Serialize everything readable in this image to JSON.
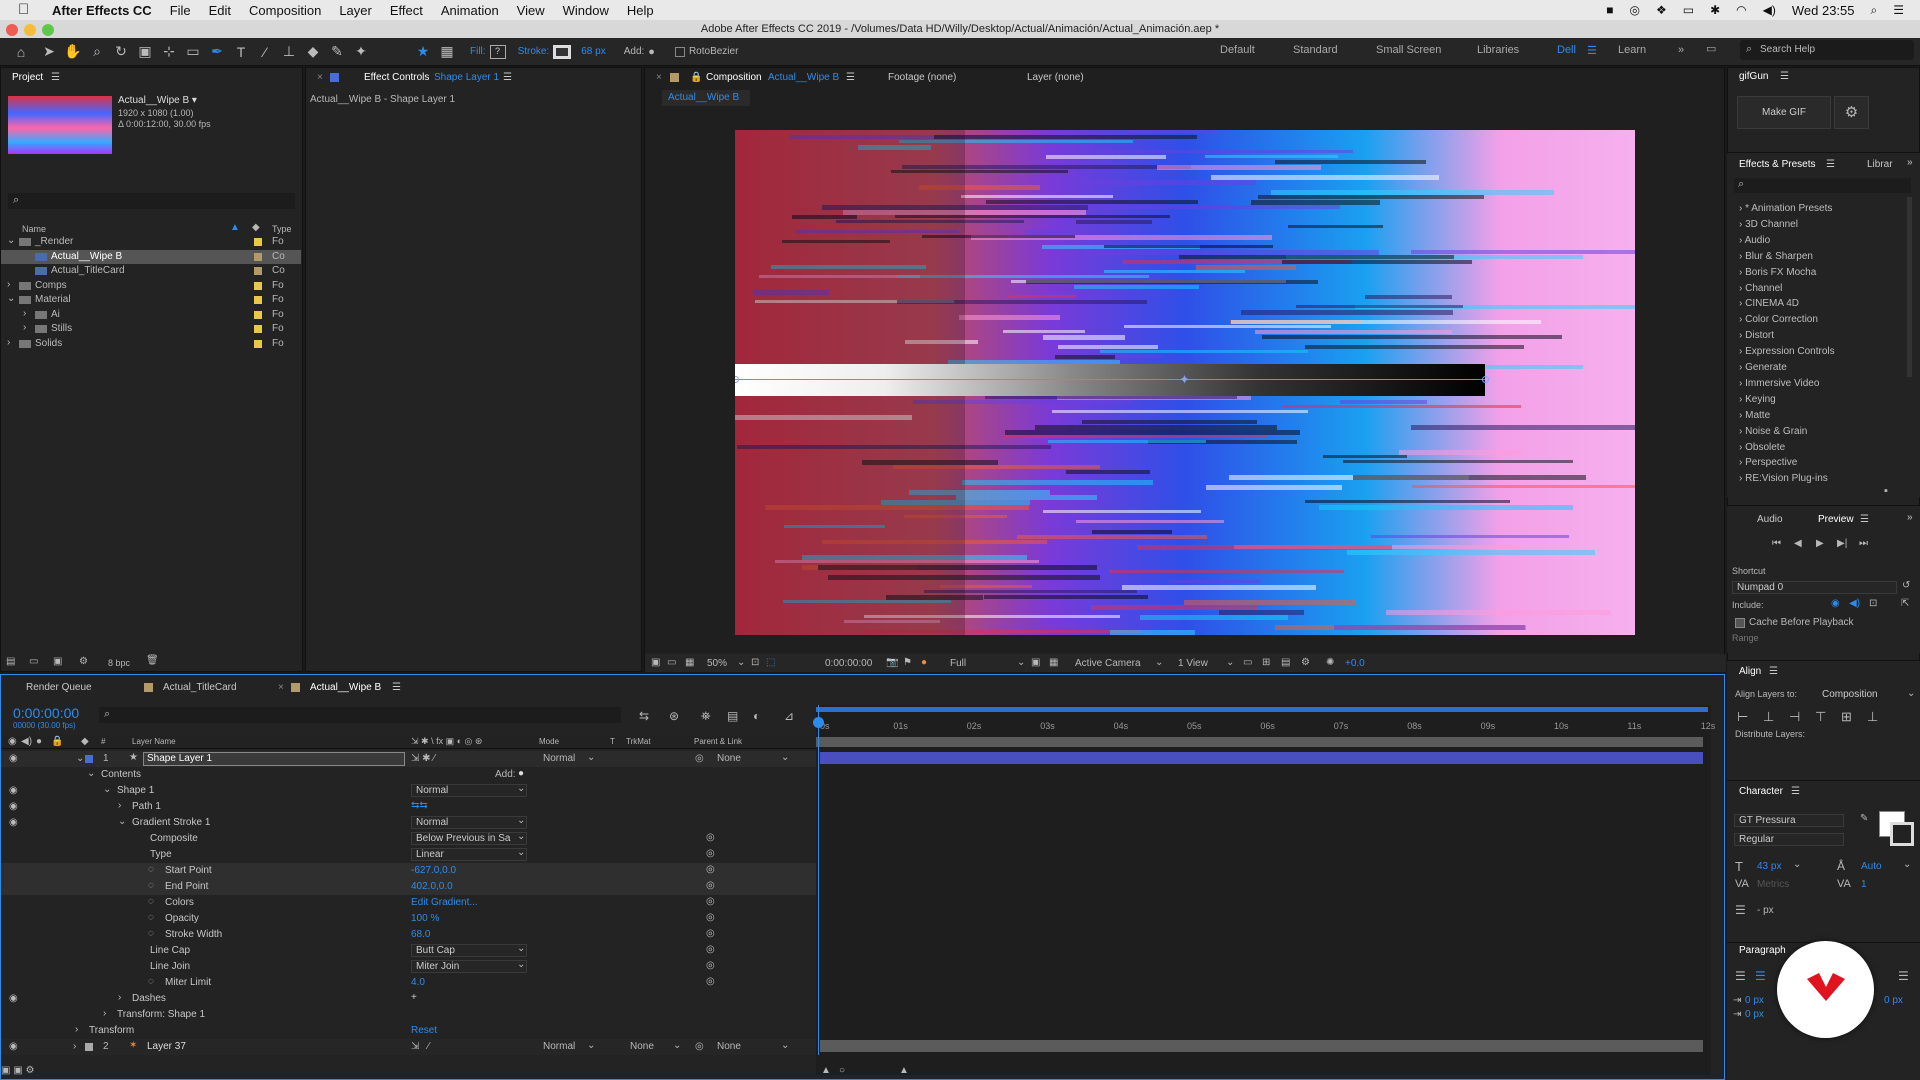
{
  "menubar": {
    "app_name": "After Effects CC",
    "items": [
      "File",
      "Edit",
      "Composition",
      "Layer",
      "Effect",
      "Animation",
      "View",
      "Window",
      "Help"
    ],
    "clock": "Wed 23:55"
  },
  "window_title": "Adobe After Effects CC 2019 - /Volumes/Data HD/Willy/Desktop/Actual/Animación/Actual_Animación.aep *",
  "toolbar": {
    "fill_label": "Fill:",
    "stroke_label": "Stroke:",
    "stroke_width": "68 px",
    "add_label": "Add:",
    "rotobezier_label": "RotoBezier",
    "workspaces": [
      "Default",
      "Standard",
      "Small Screen",
      "Libraries",
      "Dell",
      "Learn"
    ],
    "active_workspace": "Dell",
    "search_placeholder": "Search Help"
  },
  "project_panel": {
    "tab": "Project",
    "thumb_name": "Actual__Wipe B ▾",
    "thumb_info1": "1920 x 1080 (1.00)",
    "thumb_info2": "Δ 0:00:12:00, 30.00 fps",
    "col_name": "Name",
    "col_type": "Type",
    "bpc": "8 bpc",
    "items": [
      {
        "name": "_Render",
        "type": "Fo",
        "color": "#e8c84a"
      },
      {
        "name": "Actual__Wipe B",
        "type": "Co",
        "color": "#b49a6a"
      },
      {
        "name": "Actual_TitleCard",
        "type": "Co",
        "color": "#b49a6a"
      },
      {
        "name": "Comps",
        "type": "Fo",
        "color": "#e8c84a"
      },
      {
        "name": "Material",
        "type": "Fo",
        "color": "#e8c84a"
      },
      {
        "name": "Ai",
        "type": "Fo",
        "color": "#e8c84a"
      },
      {
        "name": "Stills",
        "type": "Fo",
        "color": "#e8c84a"
      },
      {
        "name": "Solids",
        "type": "Fo",
        "color": "#e8c84a"
      }
    ]
  },
  "effect_controls": {
    "tab_prefix": "Effect Controls",
    "tab_layer": "Shape Layer 1",
    "subtitle": "Actual__Wipe B - Shape Layer 1"
  },
  "composition_panel": {
    "tab_prefix": "Composition",
    "tab_comp": "Actual__Wipe B",
    "footage_tab": "Footage (none)",
    "layer_tab": "Layer (none)",
    "breadcrumb": "Actual__Wipe B",
    "zoom": "50%",
    "timecode": "0:00:00:00",
    "resolution": "Full",
    "camera": "Active Camera",
    "views": "1 View",
    "exposure": "+0.0"
  },
  "right_panel": {
    "gifgun_tab": "gifGun",
    "make_gif": "Make GIF",
    "effects_tab": "Effects & Presets",
    "libraries_tab": "Librar",
    "effects_list": [
      "* Animation Presets",
      "3D Channel",
      "Audio",
      "Blur & Sharpen",
      "Boris FX Mocha",
      "Channel",
      "CINEMA 4D",
      "Color Correction",
      "Distort",
      "Expression Controls",
      "Generate",
      "Immersive Video",
      "Keying",
      "Matte",
      "Noise & Grain",
      "Obsolete",
      "Perspective",
      "RE:Vision Plug-ins"
    ],
    "audio_tab": "Audio",
    "preview_tab": "Preview",
    "shortcut_label": "Shortcut",
    "shortcut_value": "Numpad 0",
    "include_label": "Include:",
    "cache_label": "Cache Before Playback",
    "range_label": "Range",
    "align_tab": "Align",
    "align_to_label": "Align Layers to:",
    "align_to_value": "Composition",
    "distribute_label": "Distribute Layers:",
    "character_tab": "Character",
    "font_name": "GT Pressura",
    "font_style": "Regular",
    "font_size": "43 px",
    "leading": "Auto",
    "metrics": "Metrics",
    "tracking": "1",
    "stroke_px": "- px",
    "paragraph_tab": "Paragraph",
    "indent1": "0 px",
    "indent2": "0 px",
    "indent3": "0 px"
  },
  "timeline": {
    "tabs": [
      "Render Queue",
      "Actual_TitleCard",
      "Actual__Wipe B"
    ],
    "active_tab": "Actual__Wipe B",
    "timecode": "0:00:00:00",
    "timecode_sub": "00000 (30.00 fps)",
    "col_layer_name": "Layer Name",
    "col_mode": "Mode",
    "col_t": "T",
    "col_trkmat": "TrkMat",
    "col_parent": "Parent & Link",
    "ruler": [
      "0s",
      "01s",
      "02s",
      "03s",
      "04s",
      "05s",
      "06s",
      "07s",
      "08s",
      "09s",
      "10s",
      "11s",
      "12s"
    ],
    "layers": [
      {
        "num": "1",
        "name": "Shape Layer 1",
        "mode": "Normal",
        "parent": "None"
      },
      {
        "num": "2",
        "name": "Layer 37",
        "mode": "Normal",
        "trkmat": "None",
        "parent": "None"
      }
    ],
    "props": [
      {
        "label": "Contents",
        "value": "Add:"
      },
      {
        "label": "Shape 1",
        "value": "Normal"
      },
      {
        "label": "Path 1",
        "value": ""
      },
      {
        "label": "Gradient Stroke 1",
        "value": "Normal"
      },
      {
        "label": "Composite",
        "value": "Below Previous in Sa"
      },
      {
        "label": "Type",
        "value": "Linear"
      },
      {
        "label": "Start Point",
        "value": "-627.0,0.0"
      },
      {
        "label": "End Point",
        "value": "402.0,0.0"
      },
      {
        "label": "Colors",
        "value": "Edit Gradient..."
      },
      {
        "label": "Opacity",
        "value": "100 %"
      },
      {
        "label": "Stroke Width",
        "value": "68.0"
      },
      {
        "label": "Line Cap",
        "value": "Butt Cap"
      },
      {
        "label": "Line Join",
        "value": "Miter Join"
      },
      {
        "label": "Miter Limit",
        "value": "4.0"
      },
      {
        "label": "Dashes",
        "value": ""
      },
      {
        "label": "Transform: Shape 1",
        "value": ""
      },
      {
        "label": "Transform",
        "value": "Reset"
      }
    ]
  },
  "colors": {
    "accent": "#2d8ceb",
    "panel_bg": "#232323",
    "layer_bar": "#4a4fc0"
  }
}
